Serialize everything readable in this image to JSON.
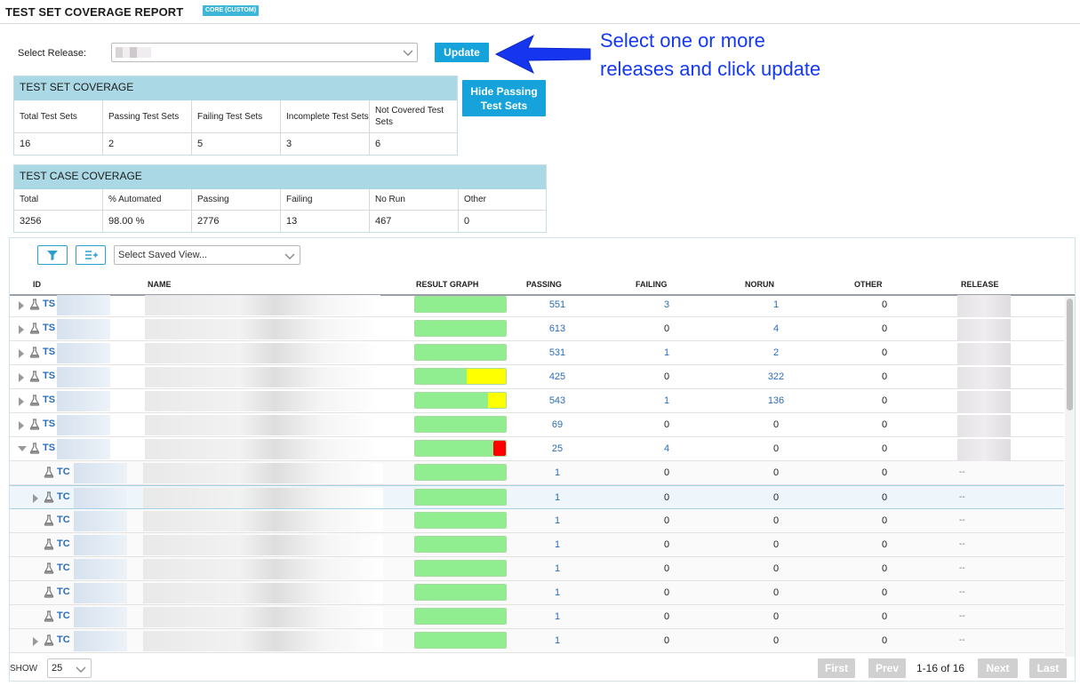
{
  "header": {
    "title": "TEST SET COVERAGE REPORT",
    "badge": "CORE (CUSTOM)"
  },
  "release": {
    "label": "Select Release:",
    "update_label": "Update"
  },
  "annotation": {
    "line1": "Select one or more",
    "line2": "releases and click update"
  },
  "hide_passing": {
    "line1": "Hide Passing",
    "line2": "Test Sets"
  },
  "test_set_coverage": {
    "title": "TEST SET COVERAGE",
    "headers": [
      "Total Test Sets",
      "Passing Test Sets",
      "Failing Test Sets",
      "Incomplete Test Sets",
      "Not Covered Test Sets"
    ],
    "values": [
      "16",
      "2",
      "5",
      "3",
      "6"
    ]
  },
  "test_case_coverage": {
    "title": "TEST CASE COVERAGE",
    "headers": [
      "Total",
      "% Automated",
      "Passing",
      "Failing",
      "No Run",
      "Other"
    ],
    "values": [
      "3256",
      "98.00 %",
      "2776",
      "13",
      "467",
      "0"
    ]
  },
  "toolbar": {
    "saved_view_placeholder": "Select Saved View..."
  },
  "grid": {
    "columns": [
      "ID",
      "NAME",
      "RESULT GRAPH",
      "PASSING",
      "FAILING",
      "NORUN",
      "OTHER",
      "RELEASE"
    ],
    "rows": [
      {
        "kind": "set",
        "expand": "right",
        "id": "TS",
        "passing": "551",
        "failing": "3",
        "norun": "1",
        "other": "0",
        "release": "",
        "result": {
          "pass": 1.0,
          "norun": 0,
          "fail": 0
        }
      },
      {
        "kind": "set",
        "expand": "right",
        "id": "TS",
        "passing": "613",
        "failing": "0",
        "norun": "4",
        "other": "0",
        "release": "",
        "result": {
          "pass": 1.0,
          "norun": 0,
          "fail": 0
        }
      },
      {
        "kind": "set",
        "expand": "right",
        "id": "TS",
        "passing": "531",
        "failing": "1",
        "norun": "2",
        "other": "0",
        "release": "",
        "result": {
          "pass": 1.0,
          "norun": 0,
          "fail": 0
        }
      },
      {
        "kind": "set",
        "expand": "right",
        "id": "TS",
        "passing": "425",
        "failing": "0",
        "norun": "322",
        "other": "0",
        "release": "",
        "result": {
          "pass": 0.57,
          "norun": 0.43,
          "fail": 0
        }
      },
      {
        "kind": "set",
        "expand": "right",
        "id": "TS",
        "passing": "543",
        "failing": "1",
        "norun": "136",
        "other": "0",
        "release": "",
        "result": {
          "pass": 0.8,
          "norun": 0.2,
          "fail": 0
        }
      },
      {
        "kind": "set",
        "expand": "right",
        "id": "TS",
        "passing": "69",
        "failing": "0",
        "norun": "0",
        "other": "0",
        "release": "",
        "result": {
          "pass": 1.0,
          "norun": 0,
          "fail": 0
        }
      },
      {
        "kind": "set",
        "expand": "down",
        "id": "TS",
        "passing": "25",
        "failing": "4",
        "norun": "0",
        "other": "0",
        "release": "",
        "result": {
          "pass": 0.86,
          "norun": 0,
          "fail": 0.14
        }
      },
      {
        "kind": "case",
        "expand": "",
        "id": "TC",
        "passing": "1",
        "failing": "0",
        "norun": "0",
        "other": "0",
        "release": "--",
        "result": {
          "pass": 1.0,
          "norun": 0,
          "fail": 0
        }
      },
      {
        "kind": "case",
        "expand": "right",
        "id": "TC",
        "passing": "1",
        "failing": "0",
        "norun": "0",
        "other": "0",
        "release": "--",
        "result": {
          "pass": 1.0,
          "norun": 0,
          "fail": 0
        },
        "selected": true
      },
      {
        "kind": "case",
        "expand": "",
        "id": "TC",
        "passing": "1",
        "failing": "0",
        "norun": "0",
        "other": "0",
        "release": "--",
        "result": {
          "pass": 1.0,
          "norun": 0,
          "fail": 0
        }
      },
      {
        "kind": "case",
        "expand": "",
        "id": "TC",
        "passing": "1",
        "failing": "0",
        "norun": "0",
        "other": "0",
        "release": "--",
        "result": {
          "pass": 1.0,
          "norun": 0,
          "fail": 0
        }
      },
      {
        "kind": "case",
        "expand": "",
        "id": "TC",
        "passing": "1",
        "failing": "0",
        "norun": "0",
        "other": "0",
        "release": "--",
        "result": {
          "pass": 1.0,
          "norun": 0,
          "fail": 0
        }
      },
      {
        "kind": "case",
        "expand": "",
        "id": "TC",
        "passing": "1",
        "failing": "0",
        "norun": "0",
        "other": "0",
        "release": "--",
        "result": {
          "pass": 1.0,
          "norun": 0,
          "fail": 0
        }
      },
      {
        "kind": "case",
        "expand": "",
        "id": "TC",
        "passing": "1",
        "failing": "0",
        "norun": "0",
        "other": "0",
        "release": "--",
        "result": {
          "pass": 1.0,
          "norun": 0,
          "fail": 0
        }
      },
      {
        "kind": "case",
        "expand": "right",
        "id": "TC",
        "passing": "1",
        "failing": "0",
        "norun": "0",
        "other": "0",
        "release": "--",
        "result": {
          "pass": 1.0,
          "norun": 0,
          "fail": 0
        }
      }
    ]
  },
  "footer": {
    "show_label": "SHOW",
    "page_size": "25",
    "first": "First",
    "prev": "Prev",
    "page_info": "1-16 of 16",
    "next": "Next",
    "last": "Last"
  },
  "colors": {
    "accent": "#16a3db",
    "pass": "#90ee90",
    "norun": "#ffff00",
    "fail": "#ff0000",
    "link": "#2a6eb8",
    "annotation": "#1439f3"
  }
}
